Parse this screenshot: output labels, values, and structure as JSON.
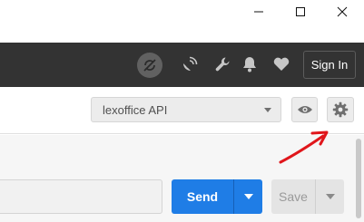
{
  "window": {
    "minimize_icon": "minimize-icon",
    "maximize_icon": "maximize-icon",
    "close_icon": "close-icon"
  },
  "header": {
    "icons": [
      "sync-off-icon",
      "satellite-icon",
      "wrench-icon",
      "bell-icon",
      "heart-icon"
    ],
    "signin_label": "Sign In"
  },
  "environment": {
    "selected": "lexoffice API",
    "eye_icon": "eye-icon",
    "settings_icon": "gear-icon"
  },
  "request": {
    "url_value": "",
    "send_label": "Send",
    "save_label": "Save"
  },
  "colors": {
    "header_bg": "#333333",
    "send_blue": "#1f7de6",
    "annotation_red": "#e0161b"
  }
}
